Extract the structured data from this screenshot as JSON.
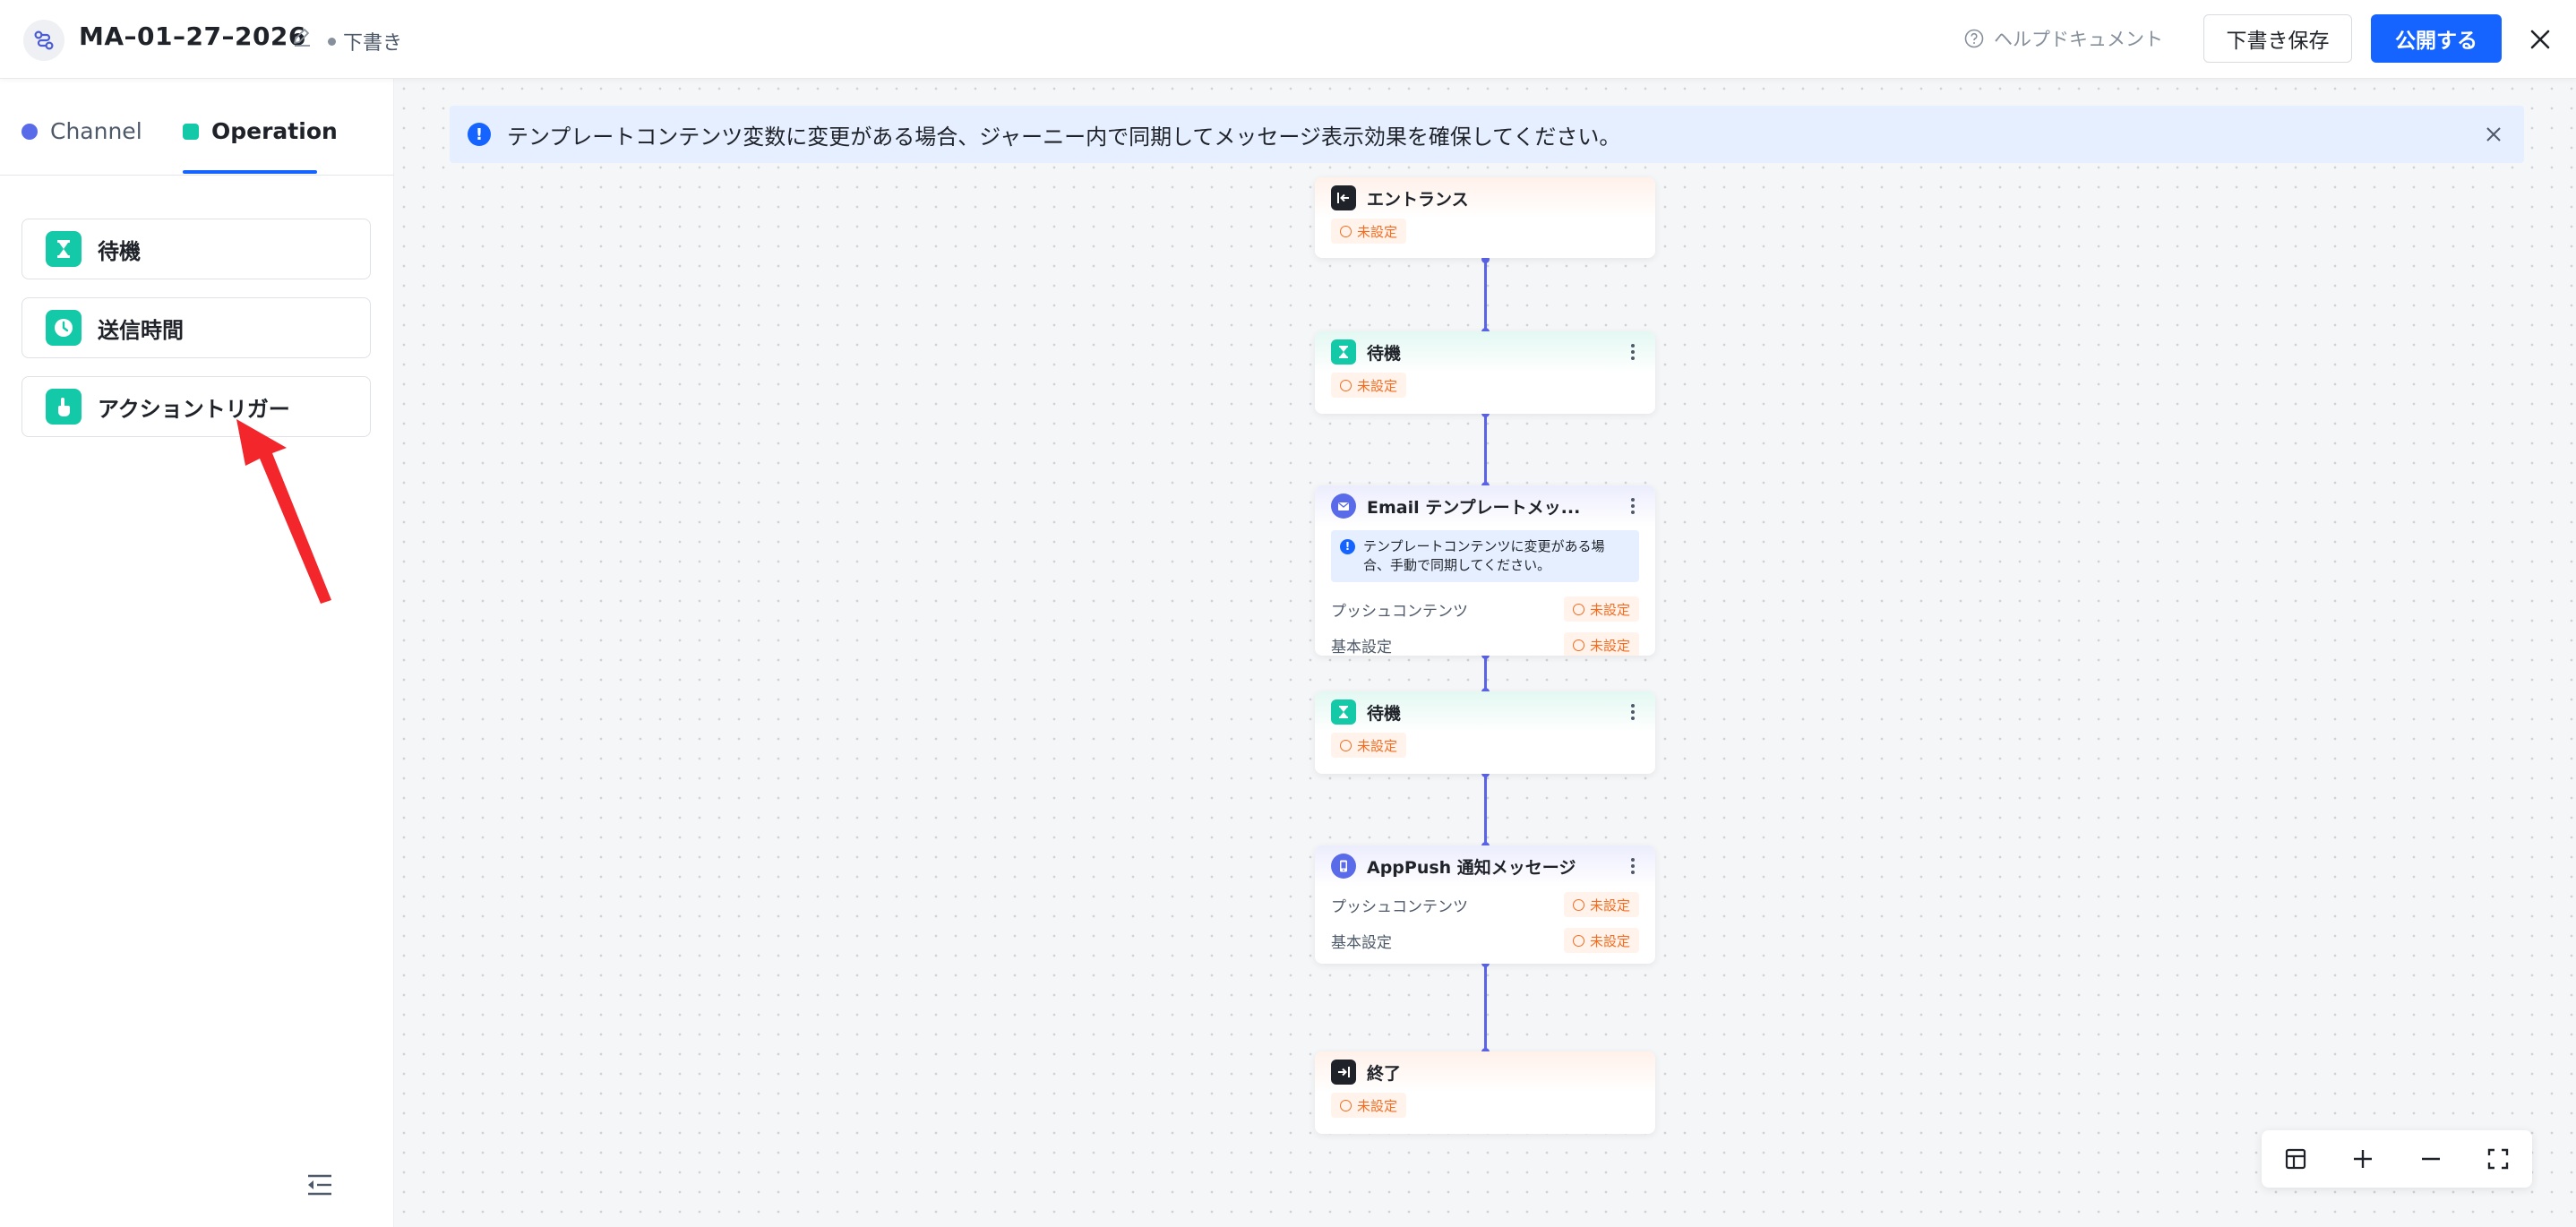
{
  "header": {
    "title": "MA–01–27–2026",
    "status": "下書き",
    "help_label": "ヘルプドキュメント",
    "save_label": "下書き保存",
    "publish_label": "公開する"
  },
  "sidebar": {
    "tabs": [
      {
        "label": "Channel"
      },
      {
        "label": "Operation"
      }
    ],
    "active_tab": "Operation",
    "items": [
      {
        "label": "待機",
        "icon": "hourglass-icon"
      },
      {
        "label": "送信時間",
        "icon": "clock-icon"
      },
      {
        "label": "アクショントリガー",
        "icon": "tap-hand-icon"
      }
    ]
  },
  "canvas": {
    "banner": "テンプレートコンテンツ変数に変更がある場合、ジャーニー内で同期してメッセージ表示効果を確保してください。",
    "nodes": [
      {
        "title": "エントランス",
        "badge": "未設定"
      },
      {
        "title": "待機",
        "badge": "未設定"
      },
      {
        "title": "Email テンプレートメッ...",
        "note": "テンプレートコンテンツに変更がある場合、手動で同期してください。",
        "rows": [
          {
            "label": "プッシュコンテンツ",
            "badge": "未設定"
          },
          {
            "label": "基本設定",
            "badge": "未設定"
          }
        ]
      },
      {
        "title": "待機",
        "badge": "未設定"
      },
      {
        "title": "AppPush 通知メッセージ",
        "rows": [
          {
            "label": "プッシュコンテンツ",
            "badge": "未設定"
          },
          {
            "label": "基本設定",
            "badge": "未設定"
          }
        ]
      },
      {
        "title": "終了",
        "badge": "未設定"
      }
    ]
  },
  "colors": {
    "primary": "#1664ff",
    "operation_green": "#14c9a8",
    "channel_blue": "#5a6bea",
    "edge": "#5b63e8",
    "warning_orange": "#f56b1f",
    "arrow_red": "#f2262b"
  }
}
